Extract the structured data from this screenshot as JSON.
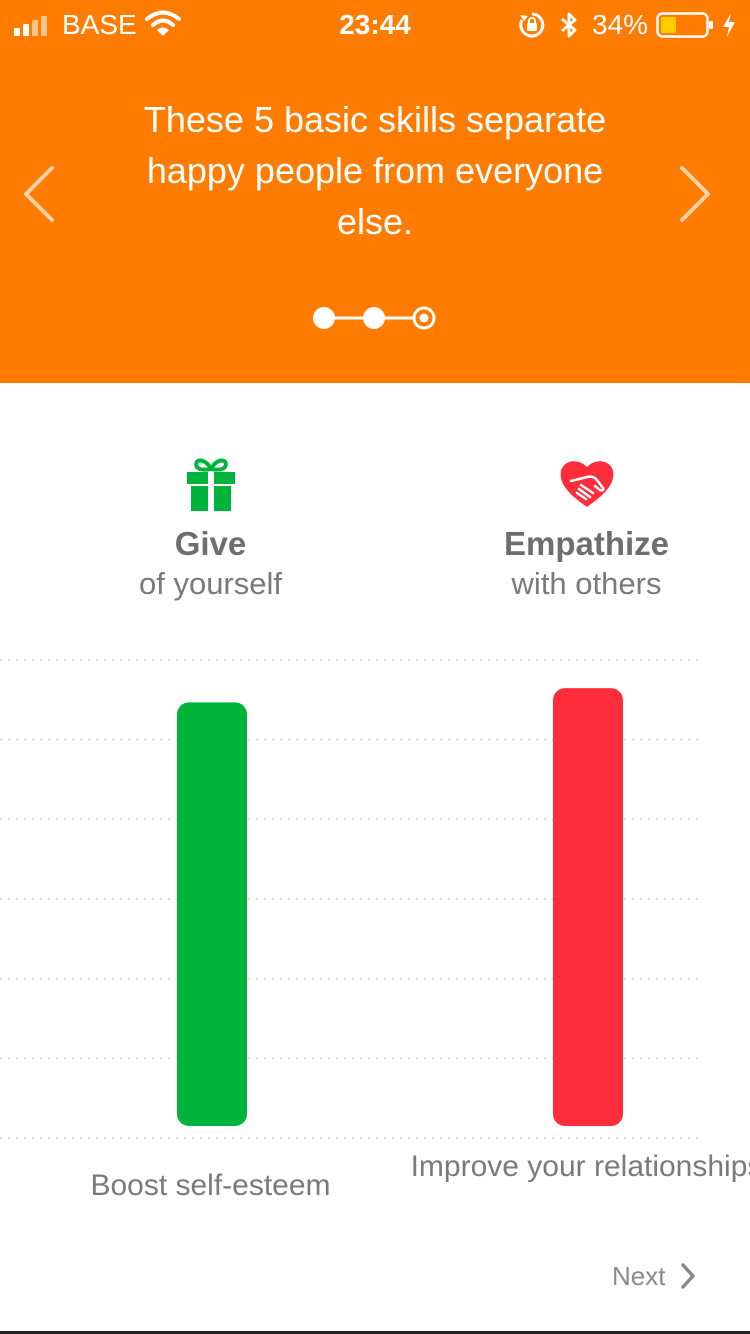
{
  "status_bar": {
    "carrier": "BASE",
    "time": "23:44",
    "battery_percent": "34%",
    "battery_level": 0.34,
    "battery_color": "#ffcc00"
  },
  "header": {
    "headline": "These 5 basic skills separate happy people from everyone else.",
    "background_color": "#ff7c00",
    "pager_total": 3,
    "pager_current": 3
  },
  "skills": [
    {
      "icon": "gift-icon",
      "title": "Give",
      "subtitle": "of yourself",
      "caption": "Boost self-esteem",
      "color": "#00b33b"
    },
    {
      "icon": "heart-hand-icon",
      "title": "Empathize",
      "subtitle": "with others",
      "caption": "Improve your relationships",
      "color": "#ff2d3c"
    }
  ],
  "chart_data": {
    "type": "bar",
    "categories": [
      "Give",
      "Empathize"
    ],
    "values": [
      0.89,
      0.92
    ],
    "colors": [
      "#00b33b",
      "#ff2d3c"
    ],
    "ylim": [
      0,
      1
    ],
    "grid": true
  },
  "footer": {
    "next_label": "Next"
  }
}
